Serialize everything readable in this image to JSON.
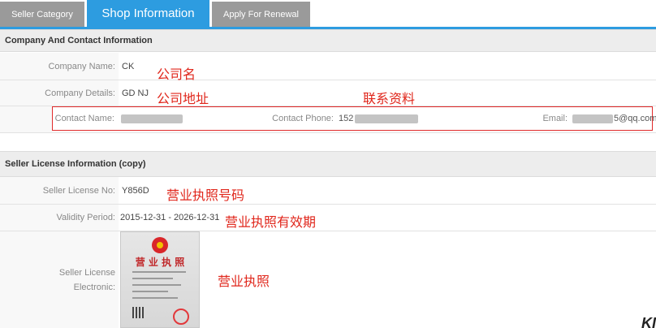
{
  "tabs": [
    {
      "label": "Seller Category",
      "active": false
    },
    {
      "label": "Shop Information",
      "active": true
    },
    {
      "label": "Apply For Renewal",
      "active": false
    }
  ],
  "company_section": {
    "title": "Company And Contact Information",
    "company_name_label": "Company Name:",
    "company_name_value": "CK",
    "company_name_note": "公司名",
    "company_details_label": "Company Details:",
    "company_details_value": "GD NJ",
    "company_details_note": "公司地址",
    "contact_note": "联系资料",
    "contact_name_label": "Contact Name:",
    "contact_phone_label": "Contact Phone:",
    "contact_phone_prefix": "152",
    "email_label": "Email:",
    "email_suffix": "5@qq.com"
  },
  "license_section": {
    "title": "Seller License Information (copy)",
    "license_no_label": "Seller License No:",
    "license_no_value": "Y856D",
    "license_no_note": "营业执照号码",
    "validity_label": "Validity Period:",
    "validity_value": "2015-12-31 - 2026-12-31",
    "validity_note": "营业执照有效期",
    "electronic_label_1": "Seller License",
    "electronic_label_2": "Electronic:",
    "electronic_note": "营业执照",
    "license_image_title": "营 业 执 照"
  },
  "corner_text": "KI",
  "colors": {
    "accent": "#2d9ce0",
    "annotation": "#e0261b",
    "inactive_tab": "#9a9a9a"
  }
}
